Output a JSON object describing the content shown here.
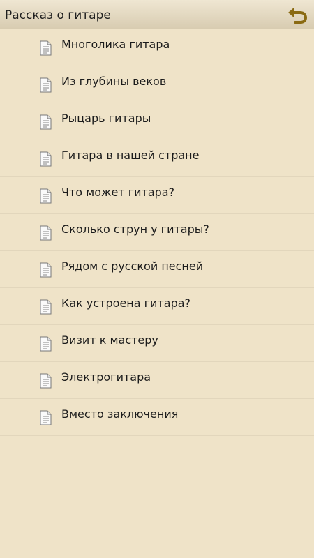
{
  "header": {
    "title": "Рассказ о гитаре",
    "back_icon": "back-arrow-icon",
    "accent_color": "#8a6a12"
  },
  "items": [
    {
      "label": "Многолика гитара",
      "icon": "document-icon"
    },
    {
      "label": "Из глубины веков",
      "icon": "document-icon"
    },
    {
      "label": "Рыцарь гитары",
      "icon": "document-icon"
    },
    {
      "label": "Гитара в нашей стране",
      "icon": "document-icon"
    },
    {
      "label": "Что может гитара?",
      "icon": "document-icon"
    },
    {
      "label": "Сколько струн у гитары?",
      "icon": "document-icon"
    },
    {
      "label": "Рядом с русской песней",
      "icon": "document-icon"
    },
    {
      "label": "Как устроена гитара?",
      "icon": "document-icon"
    },
    {
      "label": "Визит к мастеру",
      "icon": "document-icon"
    },
    {
      "label": "Электрогитара",
      "icon": "document-icon"
    },
    {
      "label": "Вместо заключения",
      "icon": "document-icon"
    }
  ]
}
